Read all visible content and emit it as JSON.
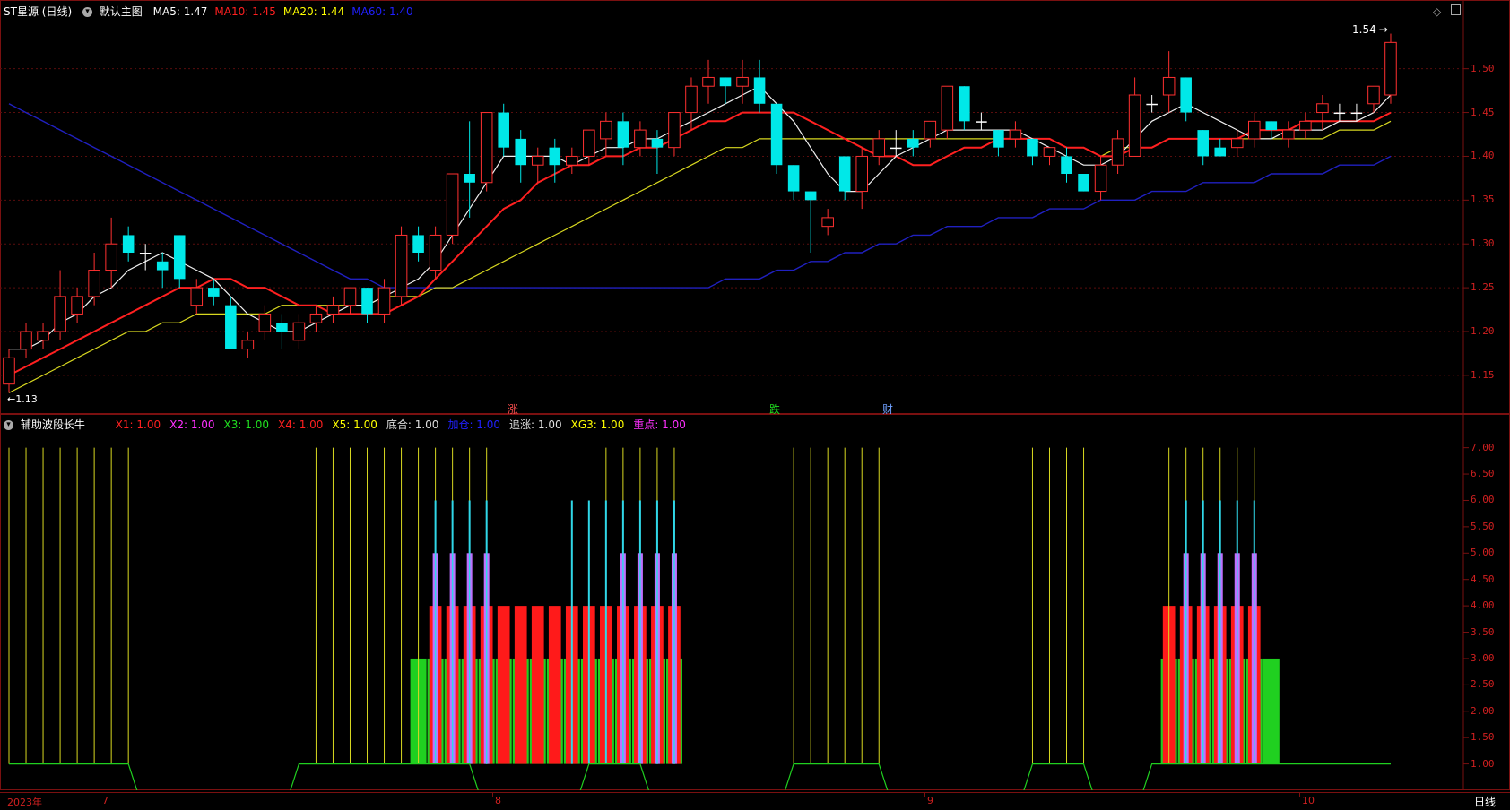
{
  "header": {
    "stock": "ST星源 (日线)",
    "template": "默认主图",
    "ma": [
      {
        "label": "MA5:",
        "value": "1.47",
        "color": "#ffffff"
      },
      {
        "label": "MA10:",
        "value": "1.45",
        "color": "#ff2020"
      },
      {
        "label": "MA20:",
        "value": "1.44",
        "color": "#ffff00"
      },
      {
        "label": "MA60:",
        "value": "1.40",
        "color": "#2020ff"
      }
    ]
  },
  "main_axis": {
    "labels": [
      "1.50",
      "1.45",
      "1.40",
      "1.35",
      "1.30",
      "1.25",
      "1.20",
      "1.15"
    ]
  },
  "price_marks": {
    "high": "1.54",
    "low": "1.13"
  },
  "event_marks": {
    "rise": "涨",
    "fall": "跌",
    "finance": "财"
  },
  "indicator": {
    "title": "辅助波段长牛",
    "items": [
      {
        "label": "X1:",
        "value": "1.00",
        "color": "#ff2020"
      },
      {
        "label": "X2:",
        "value": "1.00",
        "color": "#ff30ff"
      },
      {
        "label": "X3:",
        "value": "1.00",
        "color": "#20e020"
      },
      {
        "label": "X4:",
        "value": "1.00",
        "color": "#ff2020"
      },
      {
        "label": "X5:",
        "value": "1.00",
        "color": "#ffff00"
      },
      {
        "label": "底合:",
        "value": "1.00",
        "color": "#dddddd"
      },
      {
        "label": "加仓:",
        "value": "1.00",
        "color": "#2020ff"
      },
      {
        "label": "追涨:",
        "value": "1.00",
        "color": "#dddddd"
      },
      {
        "label": "XG3:",
        "value": "1.00",
        "color": "#ffff00"
      },
      {
        "label": "重点:",
        "value": "1.00",
        "color": "#ff30ff"
      }
    ],
    "axis_labels": [
      "7.00",
      "6.50",
      "6.00",
      "5.50",
      "5.00",
      "4.50",
      "4.00",
      "3.50",
      "3.00",
      "2.50",
      "2.00",
      "1.50",
      "1.00"
    ]
  },
  "bottom_axis": {
    "year": "2023年",
    "months": [
      "7",
      "8",
      "9",
      "10"
    ],
    "period": "日线"
  },
  "chart_data": {
    "type": "candlestick",
    "ylim": [
      1.11,
      1.56
    ],
    "candles": [
      [
        1.14,
        1.17,
        1.13,
        1.18
      ],
      [
        1.18,
        1.2,
        1.17,
        1.21
      ],
      [
        1.19,
        1.2,
        1.18,
        1.21
      ],
      [
        1.2,
        1.24,
        1.19,
        1.27
      ],
      [
        1.22,
        1.24,
        1.21,
        1.25
      ],
      [
        1.24,
        1.27,
        1.23,
        1.29
      ],
      [
        1.27,
        1.3,
        1.25,
        1.33
      ],
      [
        1.31,
        1.29,
        1.28,
        1.32
      ],
      [
        1.29,
        1.29,
        1.27,
        1.3
      ],
      [
        1.28,
        1.27,
        1.25,
        1.29
      ],
      [
        1.31,
        1.26,
        1.25,
        1.31
      ],
      [
        1.23,
        1.25,
        1.22,
        1.26
      ],
      [
        1.25,
        1.24,
        1.23,
        1.26
      ],
      [
        1.23,
        1.18,
        1.18,
        1.24
      ],
      [
        1.18,
        1.19,
        1.17,
        1.2
      ],
      [
        1.2,
        1.22,
        1.19,
        1.23
      ],
      [
        1.21,
        1.2,
        1.18,
        1.22
      ],
      [
        1.19,
        1.21,
        1.18,
        1.22
      ],
      [
        1.21,
        1.22,
        1.2,
        1.23
      ],
      [
        1.22,
        1.23,
        1.21,
        1.24
      ],
      [
        1.23,
        1.25,
        1.22,
        1.25
      ],
      [
        1.25,
        1.22,
        1.21,
        1.25
      ],
      [
        1.22,
        1.25,
        1.21,
        1.26
      ],
      [
        1.24,
        1.31,
        1.23,
        1.32
      ],
      [
        1.31,
        1.29,
        1.28,
        1.32
      ],
      [
        1.27,
        1.31,
        1.26,
        1.32
      ],
      [
        1.31,
        1.38,
        1.3,
        1.38
      ],
      [
        1.38,
        1.37,
        1.33,
        1.44
      ],
      [
        1.37,
        1.45,
        1.36,
        1.45
      ],
      [
        1.45,
        1.41,
        1.4,
        1.46
      ],
      [
        1.42,
        1.39,
        1.37,
        1.43
      ],
      [
        1.39,
        1.4,
        1.37,
        1.41
      ],
      [
        1.41,
        1.39,
        1.37,
        1.42
      ],
      [
        1.39,
        1.4,
        1.38,
        1.41
      ],
      [
        1.4,
        1.43,
        1.39,
        1.43
      ],
      [
        1.42,
        1.44,
        1.4,
        1.45
      ],
      [
        1.44,
        1.41,
        1.39,
        1.45
      ],
      [
        1.41,
        1.43,
        1.4,
        1.44
      ],
      [
        1.42,
        1.41,
        1.38,
        1.43
      ],
      [
        1.41,
        1.45,
        1.4,
        1.45
      ],
      [
        1.45,
        1.48,
        1.43,
        1.49
      ],
      [
        1.48,
        1.49,
        1.46,
        1.51
      ],
      [
        1.49,
        1.48,
        1.46,
        1.49
      ],
      [
        1.48,
        1.49,
        1.46,
        1.51
      ],
      [
        1.49,
        1.46,
        1.45,
        1.51
      ],
      [
        1.46,
        1.39,
        1.38,
        1.46
      ],
      [
        1.39,
        1.36,
        1.35,
        1.39
      ],
      [
        1.36,
        1.35,
        1.29,
        1.36
      ],
      [
        1.32,
        1.33,
        1.31,
        1.34
      ],
      [
        1.4,
        1.36,
        1.35,
        1.4
      ],
      [
        1.36,
        1.4,
        1.34,
        1.41
      ],
      [
        1.4,
        1.42,
        1.39,
        1.43
      ],
      [
        1.41,
        1.41,
        1.4,
        1.43
      ],
      [
        1.42,
        1.41,
        1.4,
        1.43
      ],
      [
        1.42,
        1.44,
        1.41,
        1.44
      ],
      [
        1.43,
        1.48,
        1.42,
        1.48
      ],
      [
        1.48,
        1.44,
        1.43,
        1.48
      ],
      [
        1.44,
        1.44,
        1.43,
        1.45
      ],
      [
        1.43,
        1.41,
        1.4,
        1.43
      ],
      [
        1.42,
        1.43,
        1.41,
        1.44
      ],
      [
        1.42,
        1.4,
        1.39,
        1.42
      ],
      [
        1.4,
        1.41,
        1.39,
        1.41
      ],
      [
        1.4,
        1.38,
        1.37,
        1.41
      ],
      [
        1.38,
        1.36,
        1.36,
        1.38
      ],
      [
        1.36,
        1.39,
        1.35,
        1.4
      ],
      [
        1.39,
        1.42,
        1.38,
        1.43
      ],
      [
        1.4,
        1.47,
        1.4,
        1.49
      ],
      [
        1.46,
        1.46,
        1.45,
        1.47
      ],
      [
        1.47,
        1.49,
        1.45,
        1.52
      ],
      [
        1.49,
        1.45,
        1.44,
        1.49
      ],
      [
        1.43,
        1.4,
        1.39,
        1.43
      ],
      [
        1.41,
        1.4,
        1.4,
        1.42
      ],
      [
        1.41,
        1.42,
        1.4,
        1.43
      ],
      [
        1.42,
        1.44,
        1.41,
        1.45
      ],
      [
        1.44,
        1.43,
        1.42,
        1.44
      ],
      [
        1.42,
        1.43,
        1.41,
        1.44
      ],
      [
        1.43,
        1.44,
        1.42,
        1.45
      ],
      [
        1.45,
        1.46,
        1.43,
        1.47
      ],
      [
        1.45,
        1.45,
        1.44,
        1.46
      ],
      [
        1.45,
        1.45,
        1.44,
        1.46
      ],
      [
        1.46,
        1.48,
        1.45,
        1.48
      ],
      [
        1.47,
        1.53,
        1.46,
        1.54
      ]
    ],
    "ma5": [
      1.18,
      1.18,
      1.19,
      1.21,
      1.22,
      1.24,
      1.25,
      1.27,
      1.28,
      1.29,
      1.28,
      1.27,
      1.26,
      1.24,
      1.22,
      1.21,
      1.2,
      1.2,
      1.21,
      1.22,
      1.23,
      1.23,
      1.24,
      1.25,
      1.26,
      1.28,
      1.31,
      1.34,
      1.37,
      1.4,
      1.4,
      1.4,
      1.4,
      1.39,
      1.4,
      1.41,
      1.41,
      1.42,
      1.42,
      1.43,
      1.44,
      1.45,
      1.46,
      1.47,
      1.48,
      1.46,
      1.44,
      1.41,
      1.38,
      1.36,
      1.36,
      1.38,
      1.4,
      1.41,
      1.42,
      1.43,
      1.43,
      1.43,
      1.43,
      1.43,
      1.42,
      1.41,
      1.4,
      1.39,
      1.39,
      1.4,
      1.42,
      1.44,
      1.45,
      1.46,
      1.45,
      1.44,
      1.43,
      1.42,
      1.42,
      1.43,
      1.43,
      1.43,
      1.44,
      1.44,
      1.45,
      1.47
    ],
    "ma10": [
      1.15,
      1.16,
      1.17,
      1.18,
      1.19,
      1.2,
      1.21,
      1.22,
      1.23,
      1.24,
      1.25,
      1.25,
      1.26,
      1.26,
      1.25,
      1.25,
      1.24,
      1.23,
      1.23,
      1.22,
      1.22,
      1.22,
      1.22,
      1.23,
      1.24,
      1.26,
      1.28,
      1.3,
      1.32,
      1.34,
      1.35,
      1.37,
      1.38,
      1.39,
      1.39,
      1.4,
      1.4,
      1.41,
      1.41,
      1.42,
      1.43,
      1.44,
      1.44,
      1.45,
      1.45,
      1.45,
      1.45,
      1.44,
      1.43,
      1.42,
      1.41,
      1.4,
      1.4,
      1.39,
      1.39,
      1.4,
      1.41,
      1.41,
      1.42,
      1.42,
      1.42,
      1.42,
      1.41,
      1.41,
      1.4,
      1.4,
      1.41,
      1.41,
      1.42,
      1.42,
      1.42,
      1.42,
      1.42,
      1.43,
      1.43,
      1.43,
      1.44,
      1.44,
      1.44,
      1.44,
      1.44,
      1.45
    ],
    "ma20": [
      1.13,
      1.14,
      1.15,
      1.16,
      1.17,
      1.18,
      1.19,
      1.2,
      1.2,
      1.21,
      1.21,
      1.22,
      1.22,
      1.22,
      1.22,
      1.22,
      1.23,
      1.23,
      1.23,
      1.23,
      1.23,
      1.23,
      1.24,
      1.24,
      1.24,
      1.25,
      1.25,
      1.26,
      1.27,
      1.28,
      1.29,
      1.3,
      1.31,
      1.32,
      1.33,
      1.34,
      1.35,
      1.36,
      1.37,
      1.38,
      1.39,
      1.4,
      1.41,
      1.41,
      1.42,
      1.42,
      1.42,
      1.42,
      1.42,
      1.42,
      1.42,
      1.42,
      1.42,
      1.42,
      1.42,
      1.42,
      1.42,
      1.42,
      1.42,
      1.42,
      1.42,
      1.42,
      1.41,
      1.41,
      1.4,
      1.41,
      1.41,
      1.41,
      1.42,
      1.42,
      1.42,
      1.42,
      1.42,
      1.42,
      1.42,
      1.42,
      1.42,
      1.42,
      1.43,
      1.43,
      1.43,
      1.44
    ],
    "ma60": [
      1.46,
      1.45,
      1.44,
      1.43,
      1.42,
      1.41,
      1.4,
      1.39,
      1.38,
      1.37,
      1.36,
      1.35,
      1.34,
      1.33,
      1.32,
      1.31,
      1.3,
      1.29,
      1.28,
      1.27,
      1.26,
      1.26,
      1.25,
      1.25,
      1.25,
      1.25,
      1.25,
      1.25,
      1.25,
      1.25,
      1.25,
      1.25,
      1.25,
      1.25,
      1.25,
      1.25,
      1.25,
      1.25,
      1.25,
      1.25,
      1.25,
      1.25,
      1.26,
      1.26,
      1.26,
      1.27,
      1.27,
      1.28,
      1.28,
      1.29,
      1.29,
      1.3,
      1.3,
      1.31,
      1.31,
      1.32,
      1.32,
      1.32,
      1.33,
      1.33,
      1.33,
      1.34,
      1.34,
      1.34,
      1.35,
      1.35,
      1.35,
      1.36,
      1.36,
      1.36,
      1.37,
      1.37,
      1.37,
      1.37,
      1.38,
      1.38,
      1.38,
      1.38,
      1.39,
      1.39,
      1.39,
      1.4
    ],
    "indicator": {
      "ylim": [
        0.5,
        7.3
      ],
      "yellow_lines": [
        0,
        1,
        2,
        3,
        4,
        5,
        6,
        7,
        18,
        19,
        20,
        21,
        22,
        23,
        24,
        25,
        26,
        27,
        28,
        35,
        36,
        37,
        38,
        39,
        46,
        47,
        48,
        49,
        50,
        51,
        60,
        61,
        62,
        63,
        68,
        69,
        70,
        71,
        72,
        73
      ],
      "yellow_height": 7,
      "cyan_lines": [
        25,
        26,
        27,
        28,
        33,
        34,
        35,
        36,
        37,
        38,
        39,
        69,
        70,
        71,
        72,
        73
      ],
      "cyan_height": 6,
      "magenta_bars": [
        25,
        26,
        27,
        28,
        36,
        37,
        38,
        39,
        69,
        70,
        71,
        72,
        73
      ],
      "magenta_height": 5,
      "red_blocks": [
        [
          25,
          39
        ],
        [
          68,
          73
        ]
      ],
      "red_height": 4,
      "green_blocks": [
        [
          24,
          39
        ],
        [
          68,
          74
        ]
      ],
      "green_height": 3,
      "baseline": 1.0,
      "step_line": [
        1,
        1,
        1,
        1,
        1,
        1,
        1,
        1,
        0,
        0,
        0,
        0,
        0,
        0,
        0,
        0,
        0,
        1,
        1,
        1,
        1,
        1,
        1,
        1,
        1,
        1,
        1,
        1,
        0,
        0,
        0,
        0,
        0,
        0,
        1,
        1,
        1,
        1,
        0,
        0,
        0,
        0,
        0,
        0,
        0,
        0,
        1,
        1,
        1,
        1,
        1,
        1,
        0,
        0,
        0,
        0,
        0,
        0,
        0,
        0,
        1,
        1,
        1,
        1,
        0,
        0,
        0,
        1,
        1,
        1,
        1,
        1,
        1,
        1,
        1,
        1,
        1,
        1,
        1,
        1,
        1,
        1
      ]
    }
  }
}
